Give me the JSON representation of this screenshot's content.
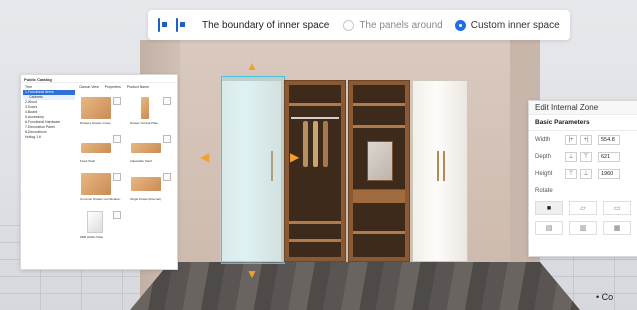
{
  "toolbar": {
    "title": "The boundary of inner space",
    "options": [
      {
        "label": "The panels around",
        "selected": false
      },
      {
        "label": "Custom inner space",
        "selected": true
      }
    ],
    "icons": [
      "select-box-icon",
      "select-region-icon"
    ],
    "accent": "#1f6fe0"
  },
  "catalog": {
    "title": "Public Catalog",
    "tree_root": "Tree",
    "tree": [
      {
        "label": "1.Functional Items",
        "selected": true
      },
      {
        "label": "Cabinets",
        "sub": true
      },
      {
        "label": "2.Wood"
      },
      {
        "label": "3.Doors"
      },
      {
        "label": "4.Board"
      },
      {
        "label": "5.Accessory"
      },
      {
        "label": "6.Functional Hardware"
      },
      {
        "label": "7.Decoration Panel"
      },
      {
        "label": "8.Decorations"
      },
      {
        "label": "Hotlog 1.6"
      }
    ],
    "tabs": [
      "Classic View",
      "Properties",
      "Product Name"
    ],
    "items": [
      {
        "label": "Drawers Drawer Group",
        "style": "wood"
      },
      {
        "label": "Drawer Vertical Plate",
        "style": "wood"
      },
      {
        "label": "Fixed Shelf",
        "style": "wood"
      },
      {
        "label": "Adjustable Shelf",
        "style": "wood"
      },
      {
        "label": "Common Drawer Combination",
        "style": "wood"
      },
      {
        "label": "Single Drawer(Internal)",
        "style": "wood"
      },
      {
        "label": "PEB HANG Plate",
        "style": "white"
      }
    ]
  },
  "edit_panel": {
    "title": "Edit Internal Zone",
    "section": "Basic Parameters",
    "params": [
      {
        "label": "Width",
        "value": "554.8",
        "icons": [
          "|+",
          "+|"
        ]
      },
      {
        "label": "Depth",
        "value": "621",
        "icons": [
          "⊥",
          "⊤"
        ]
      },
      {
        "label": "Height",
        "value": "1960",
        "icons": [
          "⊤",
          "⊥"
        ]
      }
    ],
    "rotate_label": "Rotate"
  },
  "bottom_note": "• Co"
}
